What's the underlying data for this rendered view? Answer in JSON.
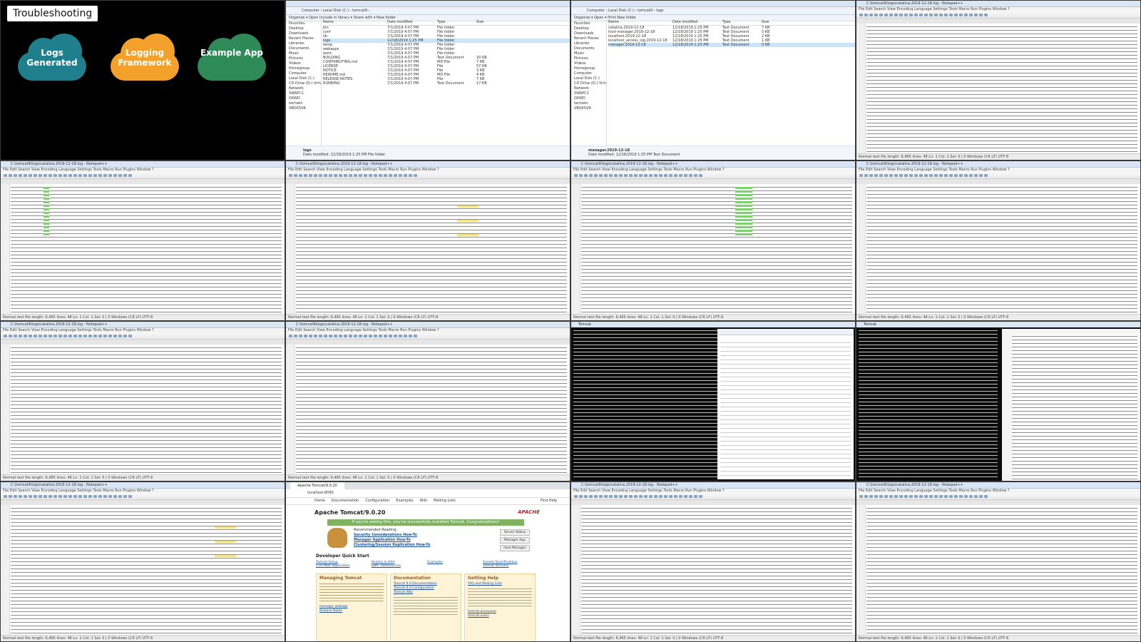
{
  "slide": {
    "title": "Troubleshooting",
    "clouds": [
      {
        "label": "Logs Generated",
        "color": "#1f7f8c"
      },
      {
        "label": "Logging Framework",
        "color": "#f4a12b"
      },
      {
        "label": "Example App",
        "color": "#2e8b57"
      }
    ]
  },
  "explorer1": {
    "address": "Computer › Local Disk (C:) › tomcat9 ›",
    "commands": "Organize ▾   Open   Include in library ▾   Share with ▾   New folder",
    "nav": [
      "Favorites",
      "Desktop",
      "Downloads",
      "Recent Places",
      "Libraries",
      "Documents",
      "Music",
      "Pictures",
      "Videos",
      "Homegroup",
      "Computer",
      "Local Disk (C:)",
      "CD Drive (D:) VirtualB",
      "Network",
      "SWAPC1",
      "OXWD",
      "techwin",
      "VBOXSVR"
    ],
    "columns": [
      "Name",
      "Date modified",
      "Type",
      "Size"
    ],
    "rows": [
      [
        "bin",
        "7/1/2019 4:07 PM",
        "File folder",
        ""
      ],
      [
        "conf",
        "7/1/2019 4:07 PM",
        "File folder",
        ""
      ],
      [
        "lib",
        "7/1/2019 4:07 PM",
        "File folder",
        ""
      ],
      [
        "logs",
        "12/18/2019 1:25 PM",
        "File folder",
        ""
      ],
      [
        "temp",
        "7/1/2019 4:07 PM",
        "File folder",
        ""
      ],
      [
        "webapps",
        "7/1/2019 4:07 PM",
        "File folder",
        ""
      ],
      [
        "work",
        "7/1/2019 4:07 PM",
        "File folder",
        ""
      ],
      [
        "BUILDING",
        "7/1/2019 4:07 PM",
        "Text Document",
        "20 KB"
      ],
      [
        "CONTRIBUTING.md",
        "7/1/2019 4:07 PM",
        "MD File",
        "7 KB"
      ],
      [
        "LICENSE",
        "7/1/2019 4:07 PM",
        "File",
        "57 KB"
      ],
      [
        "NOTICE",
        "7/1/2019 4:07 PM",
        "File",
        "3 KB"
      ],
      [
        "README.md",
        "7/1/2019 4:07 PM",
        "MD File",
        "4 KB"
      ],
      [
        "RELEASE-NOTES",
        "7/1/2019 4:07 PM",
        "File",
        "7 KB"
      ],
      [
        "RUNNING",
        "7/1/2019 4:07 PM",
        "Text Document",
        "17 KB"
      ]
    ],
    "detail_name": "logs",
    "detail_meta": "Date modified: 12/18/2019 1:25 PM   File folder"
  },
  "explorer2": {
    "address": "Computer › Local Disk (C:) › tomcat9 › logs",
    "commands": "Organize ▾   Open ▾   Print   New folder",
    "columns": [
      "Name",
      "Date modified",
      "Type",
      "Size"
    ],
    "rows": [
      [
        "catalina.2019-12-18",
        "12/18/2019 1:25 PM",
        "Text Document",
        "7 KB"
      ],
      [
        "host-manager.2019-12-18",
        "12/18/2019 1:25 PM",
        "Text Document",
        "0 KB"
      ],
      [
        "localhost.2019-12-18",
        "12/18/2019 1:25 PM",
        "Text Document",
        "2 KB"
      ],
      [
        "localhost_access_log.2019-12-18",
        "12/18/2019 1:25 PM",
        "Text Document",
        "1 KB"
      ],
      [
        "manager.2019-12-18",
        "12/18/2019 1:25 PM",
        "Text Document",
        "0 KB"
      ]
    ],
    "detail_name": "manager.2019-12-18",
    "detail_meta": "Date modified: 12/18/2019 1:25 PM   Text Document"
  },
  "notepad": {
    "title": "C:\\tomcat9\\logs\\catalina.2019-12-18.log - Notepad++",
    "menu": "File  Edit  Search  View  Encoding  Language  Settings  Tools  Macro  Run  Plugins  Window  ?",
    "tab": "catalina.2019-12-18.log",
    "status": "Normal text file        length: 6,465   lines: 48        Ln: 1   Col: 1   Sel: 0 | 0        Windows (CR LF)   UTF-8",
    "highlight_color": "#7cd36b",
    "highlight_alt": "#f3e58a"
  },
  "console": {
    "title": "Tomcat"
  },
  "browser": {
    "tab": "Apache Tomcat/9.0.20",
    "address": "localhost:8080",
    "nav": [
      "Home",
      "Documentation",
      "Configuration",
      "Examples",
      "Wiki",
      "Mailing Lists",
      "Find Help"
    ],
    "page_title": "Apache Tomcat/9.0.20",
    "logo": "APACHE",
    "banner": "If you're seeing this, you've successfully installed Tomcat. Congratulations!",
    "recommended": "Recommended Reading:",
    "links": [
      "Security Considerations How-To",
      "Manager Application How-To",
      "Clustering/Session Replication How-To"
    ],
    "buttons": [
      "Server Status",
      "Manager App",
      "Host Manager"
    ],
    "dev_title": "Developer Quick Start",
    "dev_links": [
      "Tomcat Setup",
      "Realms & AAA",
      "Examples",
      "Servlet Specifications",
      "First Web Application",
      "JDBC DataSources",
      "",
      "Tomcat Versions"
    ],
    "boxes": [
      {
        "title": "Managing Tomcat",
        "links": [
          "manager webapp",
          "Release Notes"
        ]
      },
      {
        "title": "Documentation",
        "links": [
          "Tomcat 9.0 Documentation",
          "Tomcat 9.0 Configuration",
          "Tomcat Wiki"
        ]
      },
      {
        "title": "Getting Help",
        "links": [
          "FAQ and Mailing Lists",
          "tomcat-announce",
          "tomcat-users"
        ]
      }
    ]
  }
}
